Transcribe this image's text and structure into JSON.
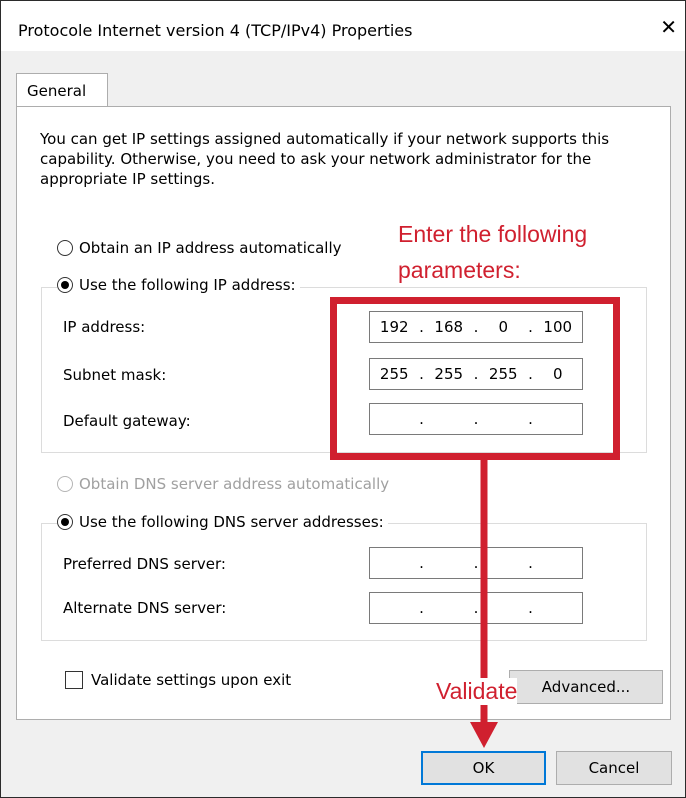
{
  "window": {
    "title": "Protocole Internet version 4 (TCP/IPv4) Properties",
    "close_symbol": "✕"
  },
  "tab": {
    "label": "General"
  },
  "description": "You can get IP settings assigned automatically if your network supports this capability. Otherwise, you need to ask your network administrator for the appropriate IP settings.",
  "ip": {
    "auto_label": "Obtain an IP address automatically",
    "manual_label": "Use the following IP address:",
    "ip_label": "IP address:",
    "ip_value": [
      "192",
      "168",
      "0",
      "100"
    ],
    "mask_label": "Subnet mask:",
    "mask_value": [
      "255",
      "255",
      "255",
      "0"
    ],
    "gateway_label": "Default gateway:"
  },
  "dns": {
    "auto_label": "Obtain DNS server address automatically",
    "manual_label": "Use the following DNS server addresses:",
    "preferred_label": "Preferred DNS server:",
    "alternate_label": "Alternate DNS server:"
  },
  "validate_label": "Validate settings upon exit",
  "buttons": {
    "advanced": "Advanced...",
    "ok": "OK",
    "cancel": "Cancel"
  },
  "annotations": {
    "enter_line1": "Enter the following",
    "enter_line2": "parameters:",
    "validate": "Validate",
    "color": "#d0202f"
  }
}
